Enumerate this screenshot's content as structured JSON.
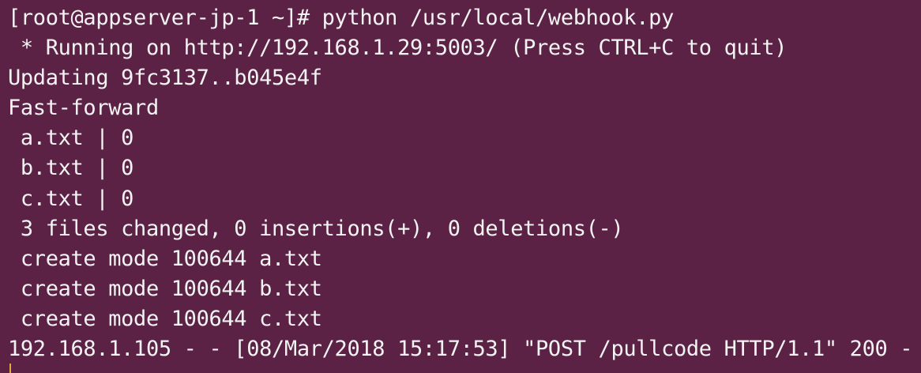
{
  "terminal": {
    "lines": [
      "[root@appserver-jp-1 ~]# python /usr/local/webhook.py",
      " * Running on http://192.168.1.29:5003/ (Press CTRL+C to quit)",
      "Updating 9fc3137..b045e4f",
      "Fast-forward",
      " a.txt | 0",
      " b.txt | 0",
      " c.txt | 0",
      " 3 files changed, 0 insertions(+), 0 deletions(-)",
      " create mode 100644 a.txt",
      " create mode 100644 b.txt",
      " create mode 100644 c.txt",
      "192.168.1.105 - - [08/Mar/2018 15:17:53] \"POST /pullcode HTTP/1.1\" 200 -"
    ]
  },
  "colors": {
    "background": "#5b2245",
    "text": "#f3f3f3",
    "cursor": "#e5a93a"
  }
}
